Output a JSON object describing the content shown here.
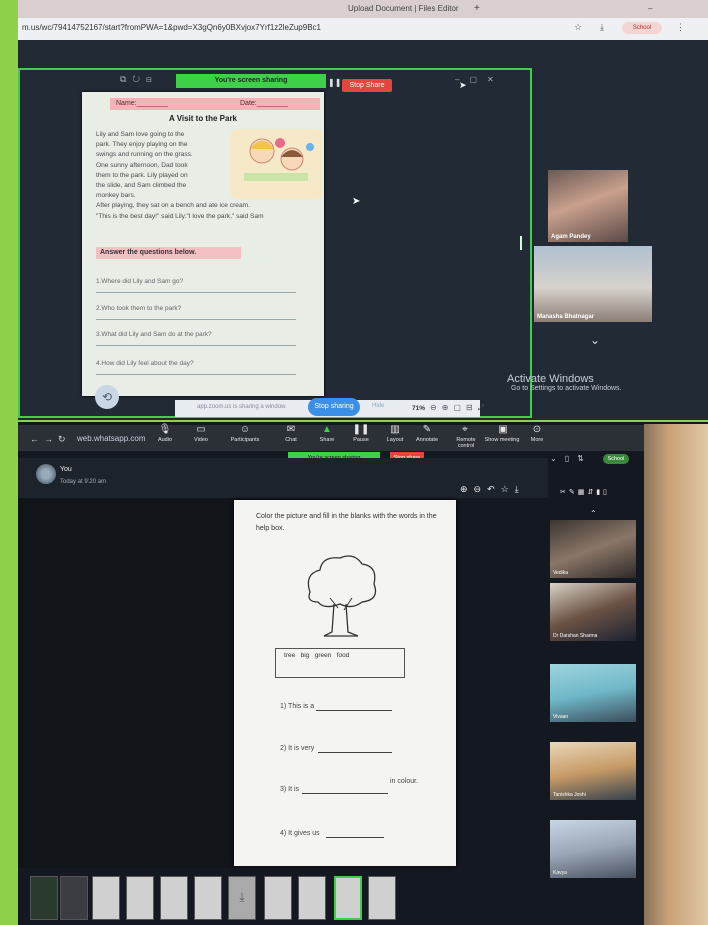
{
  "top": {
    "tabs": [
      "Upload Document | Files Editor"
    ],
    "url": "m.us/wc/79414752167/start?fromPWA=1&pwd=X3gQn6y0BXvjox7Yrf1z2leZup9Bc1",
    "profile_label": "School",
    "sharing_banner": "You're screen sharing",
    "stop_share": "Stop Share",
    "worksheet": {
      "name_label": "Name:________",
      "date_label": "Date:________",
      "title": "A Visit to the Park",
      "story": [
        "Lily and Sam love going to the",
        "park. They enjoy playing on the",
        "swings and running on the grass.",
        "One sunny afternoon, Dad took",
        "them to the park. Lily played on",
        "the slide, and Sam climbed the",
        "monkey bars.",
        "After playing, they sat on a bench and ate ice cream.",
        "\"This is the best day!\" said Lily.\"I love the park,\" said Sam"
      ],
      "questions_title": "Answer the questions below.",
      "questions": [
        "1.Where did Lily and Sam go?",
        "2.Who took them to the park?",
        "3.What did Lily and Sam do at the park?",
        "4.How did Lily feel about the day?"
      ]
    },
    "bottom_bar_hint": "app.zoom.us is sharing a window.",
    "stop_sharing": "Stop sharing",
    "hide": "Hide",
    "zoom_pct": "71%",
    "participants": [
      "Agam Pandey",
      "Manasha Bhatnagar"
    ],
    "activate_title": "Activate Windows",
    "activate_sub": "Go to Settings to activate Windows."
  },
  "bottom": {
    "url": "web.whatsapp.com",
    "toolbar": [
      "Audio",
      "Video",
      "Participants",
      "Chat",
      "Share",
      "Pause",
      "Layout",
      "Annotate",
      "Remote control",
      "Show meeting",
      "More"
    ],
    "sharing_banner": "You're screen sharing",
    "stop_share": "Stop share",
    "profile_label": "School",
    "sender": "You",
    "timestamp": "Today at 9:20 am",
    "paper": {
      "instruction": "Color the picture and fill in the blanks with the words in the help box.",
      "words": "tree   big   green   food",
      "questions": [
        "1) This is a",
        "2) It is very",
        "3) It is",
        "4) It gives us"
      ],
      "q3_suffix": "in colour."
    },
    "participants": [
      "Vedika",
      "Dr Darshan Sharma",
      "Vivaan",
      "Tanishka Joshi",
      "Kavya"
    ]
  }
}
